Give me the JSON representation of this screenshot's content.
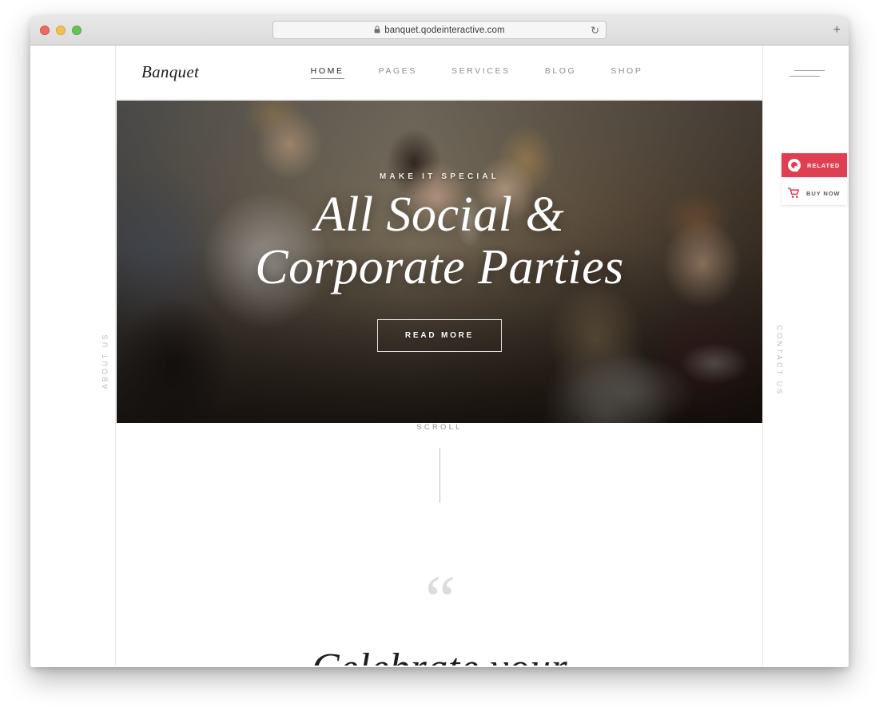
{
  "browser": {
    "url": "banquet.qodeinteractive.com",
    "lock_icon": "lock-icon",
    "reload_icon": "reload-icon",
    "reload_glyph": "↻",
    "newtab_label": "+",
    "traffic_lights": [
      "close",
      "minimize",
      "maximize"
    ]
  },
  "header": {
    "logo": "Banquet",
    "nav": [
      {
        "label": "HOME",
        "active": true
      },
      {
        "label": "PAGES",
        "active": false
      },
      {
        "label": "SERVICES",
        "active": false
      },
      {
        "label": "BLOG",
        "active": false
      },
      {
        "label": "SHOP",
        "active": false
      }
    ],
    "menu_icon": "hamburger-icon"
  },
  "side_labels": {
    "left": "ABOUT US",
    "right": "CONTACT US"
  },
  "hero": {
    "subtitle": "MAKE IT SPECIAL",
    "title_line1": "All Social &",
    "title_line2": "Corporate Parties",
    "button_label": "READ MORE",
    "image_alt": "group of people laughing and toasting with wine glasses at a restaurant table"
  },
  "scroll": {
    "label": "SCROLL"
  },
  "quote_section": {
    "quote_mark": "“",
    "heading": "Celebrate your"
  },
  "widgets": [
    {
      "name": "related",
      "label": "RELATED",
      "icon": "qode-logo-icon",
      "bg": "#e03e52",
      "fg": "#ffffff"
    },
    {
      "name": "buy-now",
      "label": "BUY NOW",
      "icon": "shopping-cart-icon",
      "bg": "#ffffff",
      "fg": "#5a5a5a"
    }
  ],
  "colors": {
    "accent": "#e03e52",
    "text_dark": "#1e1e1e",
    "text_muted": "#8d8d8d",
    "rail": "#e7e7e7"
  }
}
